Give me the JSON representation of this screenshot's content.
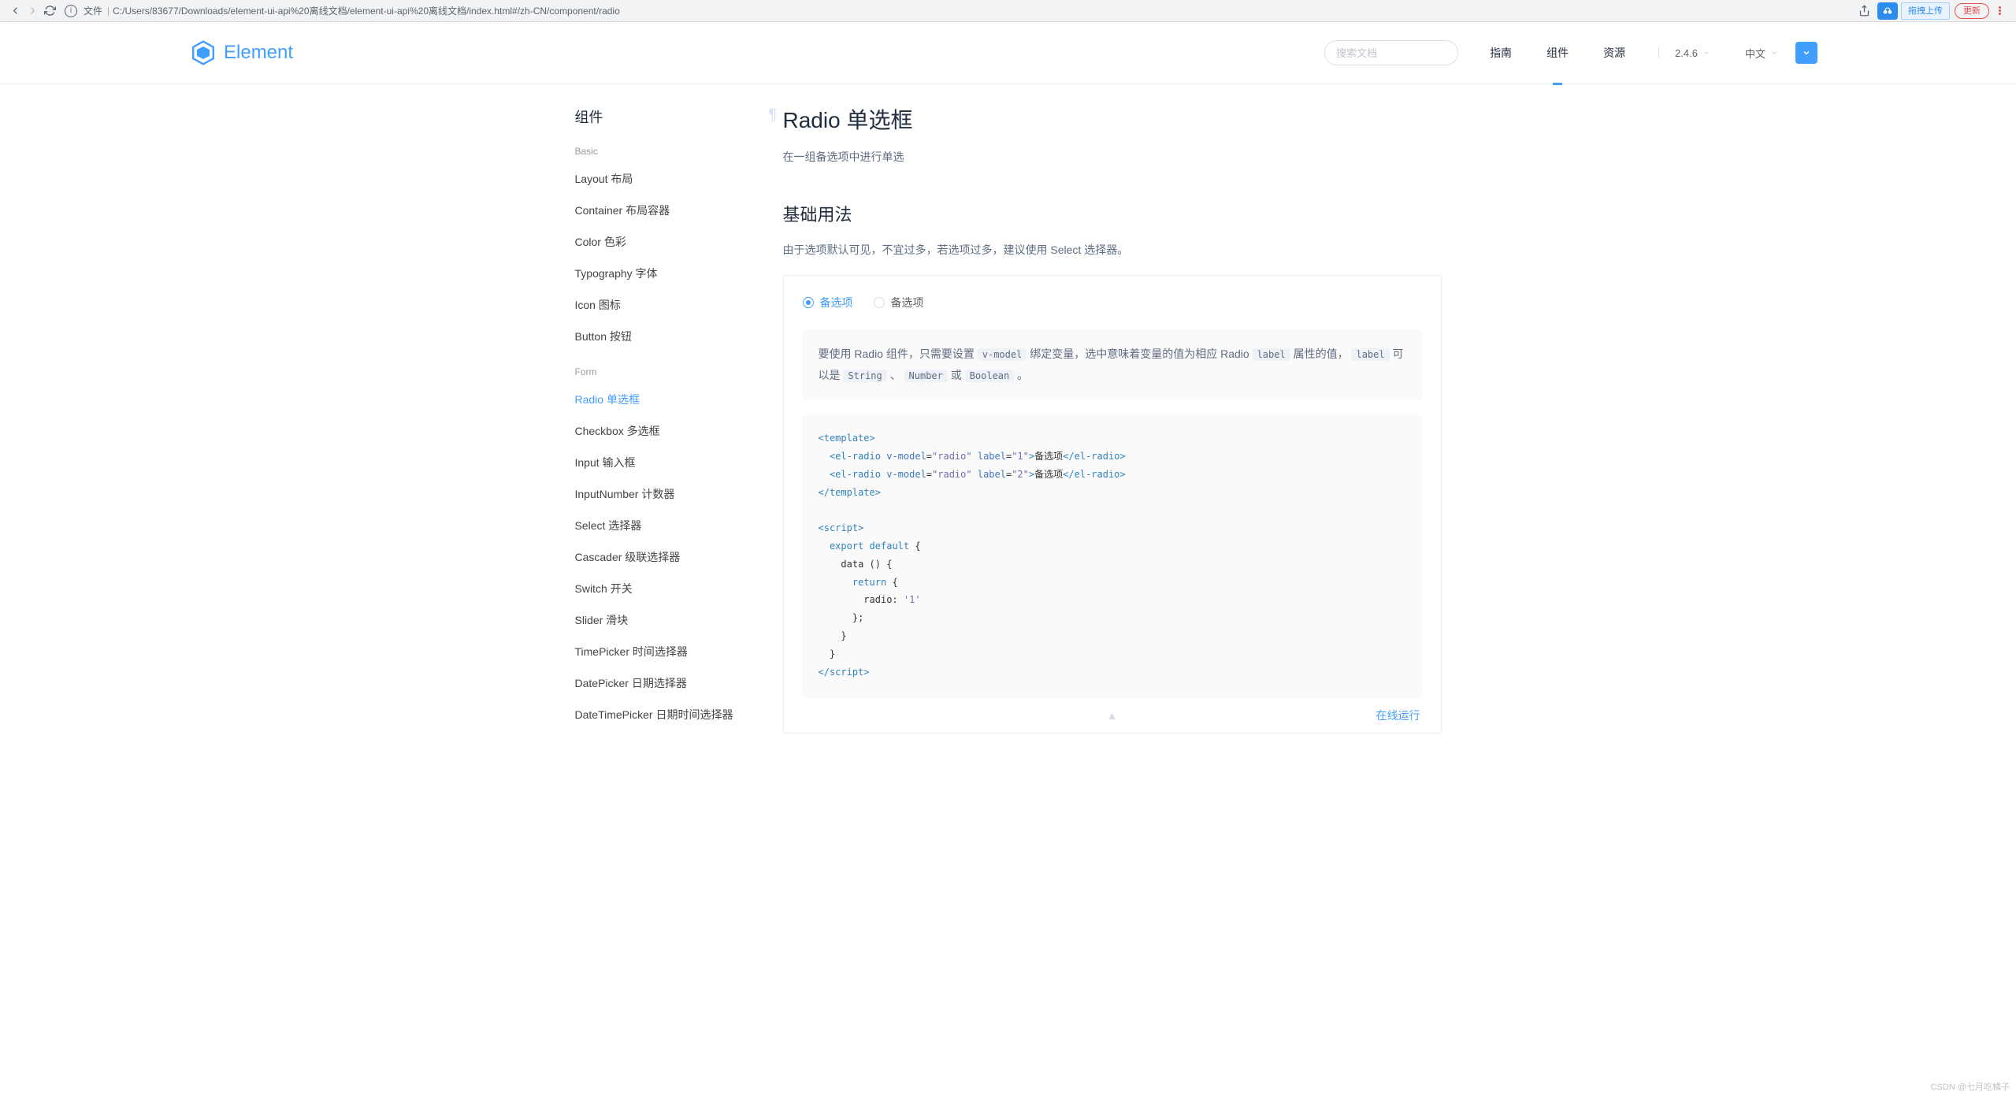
{
  "browser": {
    "url_prefix": "文件",
    "url": "C:/Users/83677/Downloads/element-ui-api%20离线文档/element-ui-api%20离线文档/index.html#/zh-CN/component/radio",
    "drag_upload": "拖拽上传",
    "update": "更新"
  },
  "header": {
    "logo": "Element",
    "search_placeholder": "搜索文档",
    "nav": {
      "guide": "指南",
      "component": "组件",
      "resource": "资源"
    },
    "version": "2.4.6",
    "lang": "中文"
  },
  "sidebar": {
    "title": "组件",
    "groups": {
      "basic": "Basic",
      "form": "Form"
    },
    "items": {
      "layout": "Layout 布局",
      "container": "Container 布局容器",
      "color": "Color 色彩",
      "typography": "Typography 字体",
      "icon": "Icon 图标",
      "button": "Button 按钮",
      "radio": "Radio 单选框",
      "checkbox": "Checkbox 多选框",
      "input": "Input 输入框",
      "inputnumber": "InputNumber 计数器",
      "select": "Select 选择器",
      "cascader": "Cascader 级联选择器",
      "switch": "Switch 开关",
      "slider": "Slider 滑块",
      "timepicker": "TimePicker 时间选择器",
      "datepicker": "DatePicker 日期选择器",
      "datetimepicker": "DateTimePicker 日期时间选择器"
    }
  },
  "content": {
    "title": "Radio 单选框",
    "desc": "在一组备选项中进行单选",
    "section1_title": "基础用法",
    "section1_desc": "由于选项默认可见，不宜过多，若选项过多，建议使用 Select 选择器。",
    "radio_opt1": "备选项",
    "radio_opt2": "备选项",
    "explain_p1a": "要使用 Radio 组件，只需要设置",
    "explain_p1b": "绑定变量，选中意味着变量的值为相应 Radio",
    "explain_p1c": "属性的值，",
    "explain_p1d": "可以是",
    "explain_p2_sep": "、",
    "explain_p2_or": "或",
    "explain_p2_end": "。",
    "tags": {
      "vmodel": "v-model",
      "label": "label",
      "string": "String",
      "number": "Number",
      "boolean": "Boolean"
    },
    "code_text_opt": "备选项",
    "run_online": "在线运行"
  },
  "watermark": "CSDN @七月吃橘子"
}
